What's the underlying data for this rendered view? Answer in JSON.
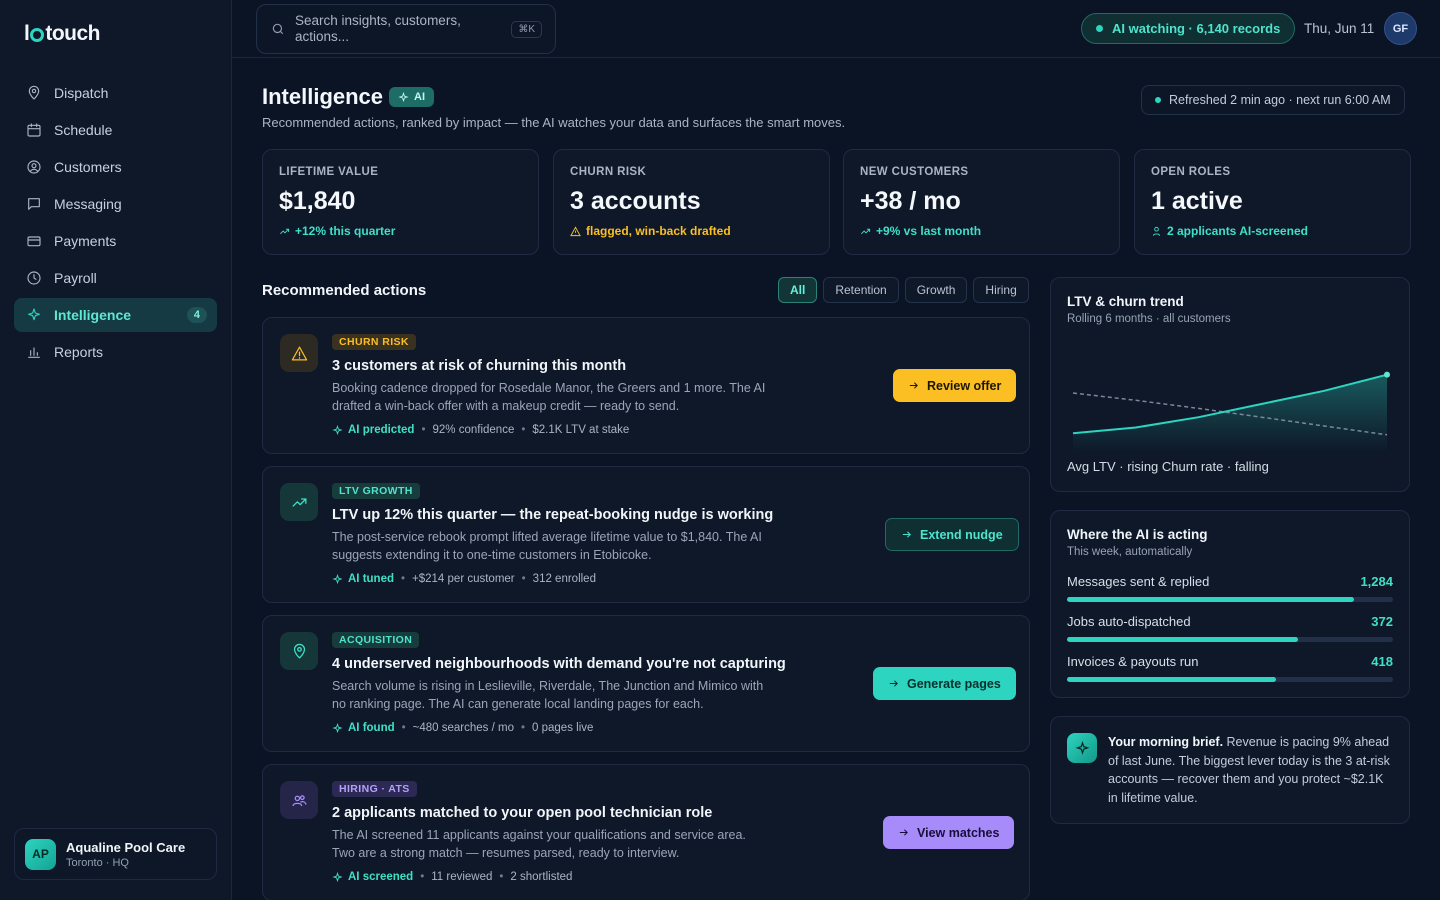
{
  "app": {
    "logo_left": "l",
    "logo_right": "touch"
  },
  "sidebar": {
    "items": [
      {
        "label": "Dispatch",
        "icon": "map-pin-icon"
      },
      {
        "label": "Schedule",
        "icon": "calendar-icon"
      },
      {
        "label": "Customers",
        "icon": "user-circle-icon"
      },
      {
        "label": "Messaging",
        "icon": "message-icon"
      },
      {
        "label": "Payments",
        "icon": "credit-card-icon"
      },
      {
        "label": "Payroll",
        "icon": "clock-icon"
      },
      {
        "label": "Intelligence",
        "icon": "sparkle-icon",
        "count": "4",
        "active": true
      },
      {
        "label": "Reports",
        "icon": "bar-chart-icon"
      }
    ],
    "business": {
      "initials": "AP",
      "name": "Aqualine Pool Care",
      "location": "Toronto · HQ"
    }
  },
  "topbar": {
    "search_placeholder": "Search insights, customers, actions...",
    "shortcut": "⌘K",
    "ai_status": "AI watching · 6,140 records",
    "date": "Thu, Jun 11",
    "user_initials": "GF"
  },
  "header": {
    "title": "Intelligence",
    "ai_tag": "AI",
    "subtitle": "Recommended actions, ranked by impact — the AI watches your data and surfaces the smart moves.",
    "refresh": "Refreshed 2 min ago · next run 6:00 AM"
  },
  "kpis": [
    {
      "label": "LIFETIME VALUE",
      "value": "$1,840",
      "delta": "+12% this quarter"
    },
    {
      "label": "CHURN RISK",
      "value": "3 accounts",
      "delta": "flagged, win-back drafted"
    },
    {
      "label": "NEW CUSTOMERS",
      "value": "+38 / mo",
      "delta": "+9% vs last month"
    },
    {
      "label": "OPEN ROLES",
      "value": "1 active",
      "delta": "2 applicants AI-screened"
    }
  ],
  "actions": {
    "title": "Recommended actions",
    "filters": [
      "All",
      "Retention",
      "Growth",
      "Hiring"
    ],
    "cards": [
      {
        "tag": "CHURN RISK",
        "title": "3 customers at risk of churning this month",
        "desc": "Booking cadence dropped for Rosedale Manor, the Greers and 1 more. The AI drafted a win-back offer with a makeup credit — ready to send.",
        "ai": "AI predicted",
        "meta1": "92% confidence",
        "meta2": "$2.1K LTV at stake",
        "button": "Review offer"
      },
      {
        "tag": "LTV GROWTH",
        "title": "LTV up 12% this quarter — the repeat-booking nudge is working",
        "desc": "The post-service rebook prompt lifted average lifetime value to $1,840. The AI suggests extending it to one-time customers in Etobicoke.",
        "ai": "AI tuned",
        "meta1": "+$214 per customer",
        "meta2": "312 enrolled",
        "button": "Extend nudge"
      },
      {
        "tag": "ACQUISITION",
        "title": "4 underserved neighbourhoods with demand you're not capturing",
        "desc": "Search volume is rising in Leslieville, Riverdale, The Junction and Mimico with no ranking page. The AI can generate local landing pages for each.",
        "ai": "AI found",
        "meta1": "~480 searches / mo",
        "meta2": "0 pages live",
        "button": "Generate pages"
      },
      {
        "tag": "HIRING · ATS",
        "title": "2 applicants matched to your open pool technician role",
        "desc": "The AI screened 11 applicants against your qualifications and service area. Two are a strong match — resumes parsed, ready to interview.",
        "ai": "AI screened",
        "meta1": "11 reviewed",
        "meta2": "2 shortlisted",
        "button": "View matches"
      }
    ]
  },
  "trend": {
    "title": "LTV & churn trend",
    "subtitle": "Rolling 6 months · all customers",
    "legend": "Avg LTV · rising Churn rate · falling"
  },
  "chart_data": {
    "type": "line",
    "title": "LTV & churn trend",
    "x": [
      1,
      2,
      3,
      4,
      5,
      6
    ],
    "series": [
      {
        "name": "Avg LTV",
        "values": [
          0.2,
          0.28,
          0.42,
          0.6,
          0.78,
          1.0
        ]
      },
      {
        "name": "Churn rate",
        "values": [
          0.75,
          0.65,
          0.54,
          0.42,
          0.3,
          0.18
        ]
      }
    ],
    "ylim": [
      0,
      1.2
    ],
    "grid": false
  },
  "acting": {
    "title": "Where the AI is acting",
    "subtitle": "This week, automatically",
    "rows": [
      {
        "label": "Messages sent & replied",
        "value": "1,284",
        "fraction": 0.88
      },
      {
        "label": "Jobs auto-dispatched",
        "value": "372",
        "fraction": 0.71
      },
      {
        "label": "Invoices & payouts run",
        "value": "418",
        "fraction": 0.64
      }
    ]
  },
  "brief": {
    "lead": "Your morning brief.",
    "text": " Revenue is pacing 9% ahead of last June. The biggest lever today is the 3 at-risk accounts — recover them and you protect ~$2.1K in lifetime value."
  },
  "colors": {
    "accent": "#2dd4bf",
    "amber": "#fbbf24",
    "purple": "#a78bfa",
    "bg": "#0b1424"
  }
}
